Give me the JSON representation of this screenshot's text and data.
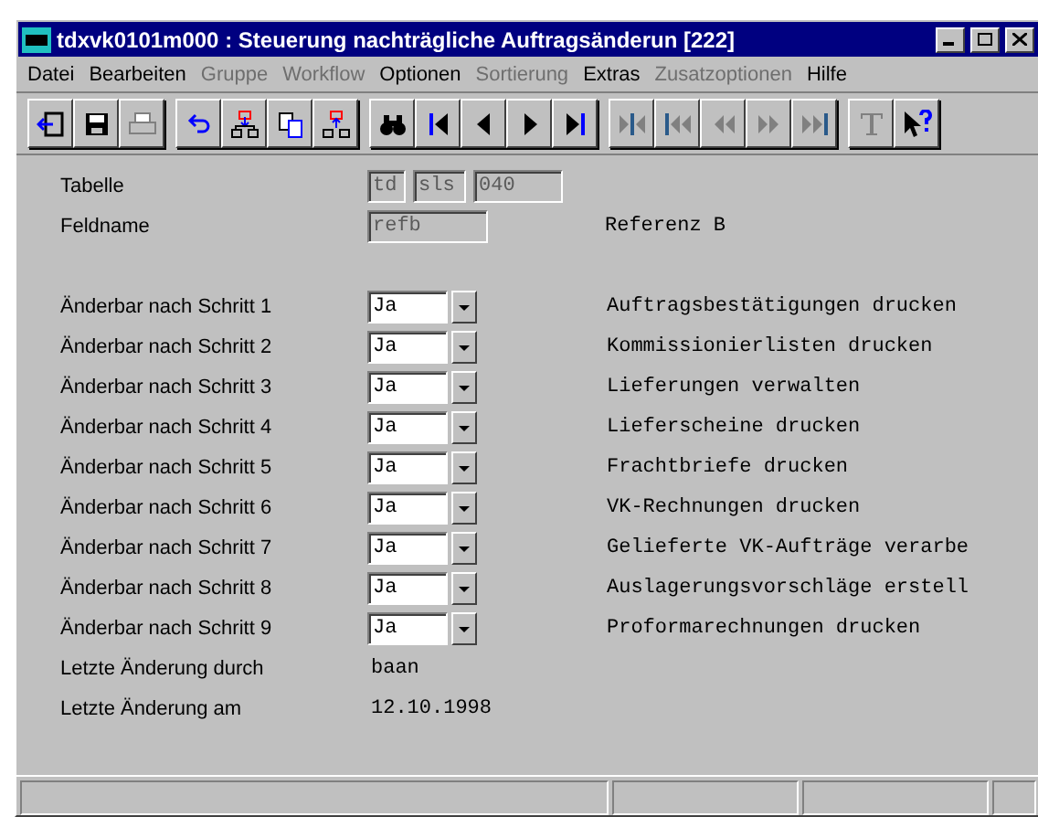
{
  "window": {
    "title": "tdxvk0101m000 : Steuerung nachträgliche Auftragsänderun [222]"
  },
  "menu": [
    {
      "label": "Datei",
      "disabled": false
    },
    {
      "label": "Bearbeiten",
      "disabled": false
    },
    {
      "label": "Gruppe",
      "disabled": true
    },
    {
      "label": "Workflow",
      "disabled": true
    },
    {
      "label": "Optionen",
      "disabled": false
    },
    {
      "label": "Sortierung",
      "disabled": true
    },
    {
      "label": "Extras",
      "disabled": false
    },
    {
      "label": "Zusatzoptionen",
      "disabled": true
    },
    {
      "label": "Hilfe",
      "disabled": false
    }
  ],
  "toolbar": [
    [
      {
        "kind": "exit",
        "disabled": false
      },
      {
        "kind": "save",
        "disabled": false
      },
      {
        "kind": "print",
        "disabled": true
      }
    ],
    [
      {
        "kind": "undo",
        "disabled": false
      },
      {
        "kind": "insert",
        "disabled": false
      },
      {
        "kind": "copy",
        "disabled": false
      },
      {
        "kind": "extract",
        "disabled": false
      }
    ],
    [
      {
        "kind": "find",
        "disabled": false
      },
      {
        "kind": "first",
        "disabled": false
      },
      {
        "kind": "prev",
        "disabled": false
      },
      {
        "kind": "next",
        "disabled": false
      },
      {
        "kind": "last",
        "disabled": false
      }
    ],
    [
      {
        "kind": "first-set",
        "disabled": true
      },
      {
        "kind": "first-page",
        "disabled": true
      },
      {
        "kind": "prev-page",
        "disabled": true
      },
      {
        "kind": "next-page",
        "disabled": true
      },
      {
        "kind": "last-page",
        "disabled": true
      }
    ],
    [
      {
        "kind": "text",
        "disabled": true
      },
      {
        "kind": "help",
        "disabled": false
      }
    ]
  ],
  "table": {
    "label": "Tabelle",
    "parts": [
      "td",
      "sls",
      "040"
    ]
  },
  "field_name": {
    "label": "Feldname",
    "value": "refb",
    "description": "Referenz B"
  },
  "steps": [
    {
      "label": "Änderbar nach Schritt 1",
      "value": "Ja",
      "description": "Auftragsbestätigungen drucken"
    },
    {
      "label": "Änderbar nach Schritt 2",
      "value": "Ja",
      "description": "Kommissionierlisten drucken"
    },
    {
      "label": "Änderbar nach Schritt 3",
      "value": "Ja",
      "description": "Lieferungen verwalten"
    },
    {
      "label": "Änderbar nach Schritt 4",
      "value": "Ja",
      "description": "Lieferscheine drucken"
    },
    {
      "label": "Änderbar nach Schritt 5",
      "value": "Ja",
      "description": "Frachtbriefe drucken"
    },
    {
      "label": "Änderbar nach Schritt 6",
      "value": "Ja",
      "description": "VK-Rechnungen drucken"
    },
    {
      "label": "Änderbar nach Schritt 7",
      "value": "Ja",
      "description": "Gelieferte VK-Aufträge verarbe"
    },
    {
      "label": "Änderbar nach Schritt 8",
      "value": "Ja",
      "description": "Auslagerungsvorschläge erstell"
    },
    {
      "label": "Änderbar nach Schritt 9",
      "value": "Ja",
      "description": "Proformarechnungen drucken"
    }
  ],
  "info": [
    {
      "label": "Letzte Änderung durch",
      "value": "baan"
    },
    {
      "label": "Letzte Änderung am",
      "value": "12.10.1998"
    }
  ]
}
